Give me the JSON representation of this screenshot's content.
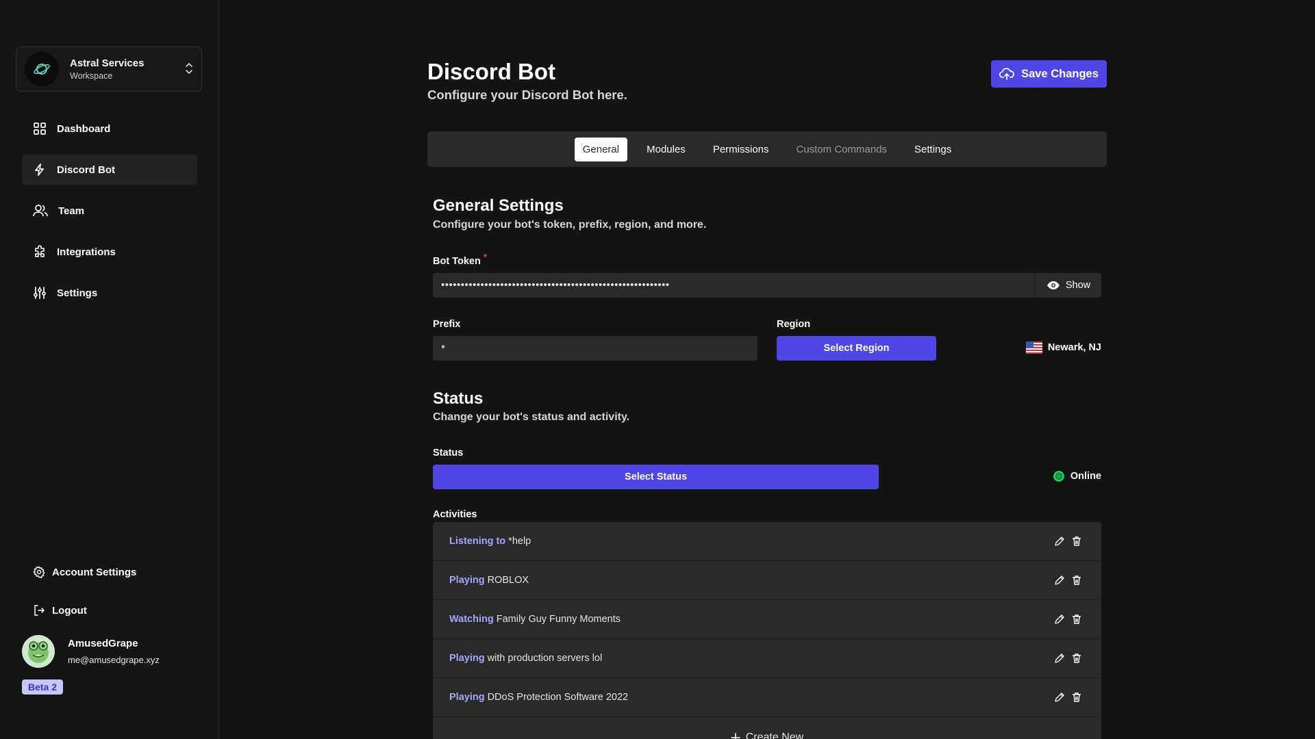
{
  "workspace": {
    "name": "Astral Services",
    "subtitle": "Workspace"
  },
  "nav": {
    "items": [
      {
        "label": "Dashboard",
        "icon": "grid-icon"
      },
      {
        "label": "Discord Bot",
        "icon": "lightning-icon",
        "active": true
      },
      {
        "label": "Team",
        "icon": "users-icon"
      },
      {
        "label": "Integrations",
        "icon": "puzzle-icon"
      },
      {
        "label": "Settings",
        "icon": "sliders-icon"
      }
    ]
  },
  "sidebar_bottom": {
    "account_settings": "Account Settings",
    "logout": "Logout"
  },
  "user": {
    "name": "AmusedGrape",
    "email": "me@amusedgrape.xyz",
    "badge": "Beta 2"
  },
  "header": {
    "title": "Discord Bot",
    "subtitle": "Configure your Discord Bot here.",
    "save_label": "Save Changes"
  },
  "tabs": [
    {
      "label": "General",
      "active": true
    },
    {
      "label": "Modules"
    },
    {
      "label": "Permissions"
    },
    {
      "label": "Custom Commands",
      "muted": true
    },
    {
      "label": "Settings"
    }
  ],
  "general": {
    "title": "General Settings",
    "subtitle": "Configure your bot's token, prefix, region, and more.",
    "token_label": "Bot Token",
    "token_required_mark": "*",
    "token_masked": "••••••••••••••••••••••••••••••••••••••••••••••••••••••••••",
    "token_show_label": "Show",
    "prefix_label": "Prefix",
    "prefix_value": "*",
    "region_label": "Region",
    "region_button": "Select Region",
    "region_value": "Newark, NJ"
  },
  "status": {
    "title": "Status",
    "subtitle": "Change your bot's status and activity.",
    "status_label": "Status",
    "status_button": "Select Status",
    "status_value": "Online",
    "status_color": "#22c55e",
    "activities_label": "Activities",
    "activities": [
      {
        "verb": "Listening to",
        "text": "*help"
      },
      {
        "verb": "Playing",
        "text": "ROBLOX"
      },
      {
        "verb": "Watching",
        "text": "Family Guy Funny Moments"
      },
      {
        "verb": "Playing",
        "text": "with production servers lol"
      },
      {
        "verb": "Playing",
        "text": "DDoS Protection Software 2022"
      }
    ],
    "create_new": "Create New"
  },
  "colors": {
    "accent": "#4f46e5",
    "verb": "#a5a7ff",
    "background": "#141414",
    "surface": "#2a2a2a"
  }
}
